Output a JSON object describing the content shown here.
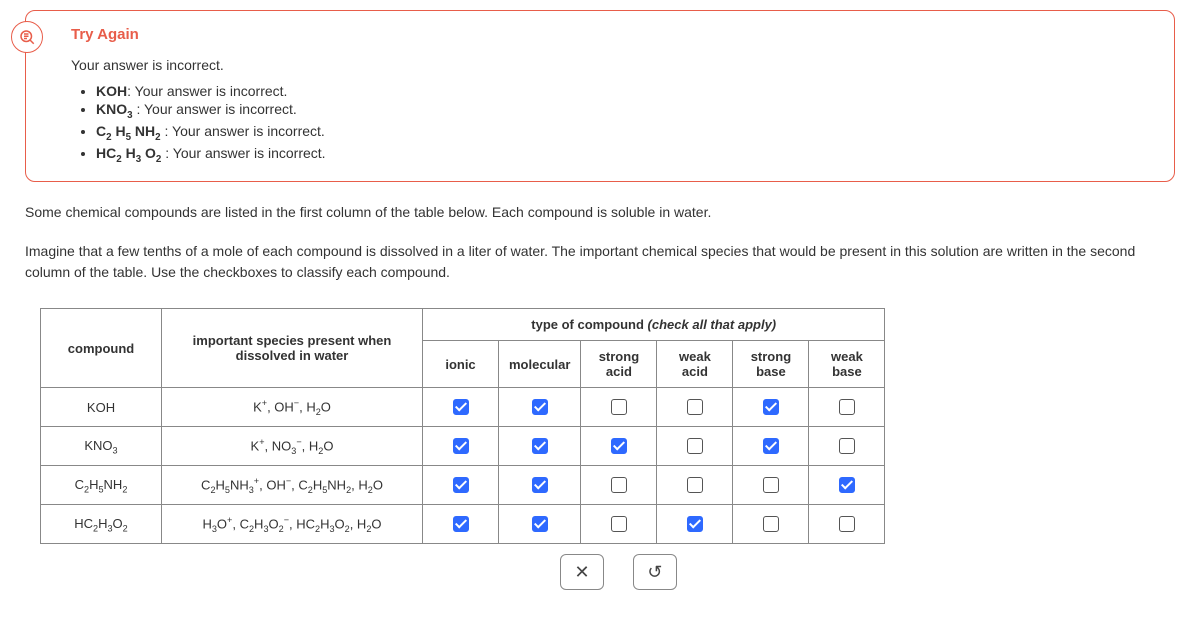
{
  "feedback": {
    "title": "Try Again",
    "summary": "Your answer is incorrect.",
    "items": [
      {
        "compound_html": "KOH",
        "msg": ": Your answer is incorrect."
      },
      {
        "compound_html": "KNO<sub>3</sub>",
        "msg": " : Your answer is incorrect."
      },
      {
        "compound_html": "C<sub>2</sub> H<sub>5</sub> NH<sub>2</sub>",
        "msg": " : Your answer is incorrect."
      },
      {
        "compound_html": "HC<sub>2</sub> H<sub>3</sub> O<sub>2</sub>",
        "msg": " : Your answer is incorrect."
      }
    ]
  },
  "question": {
    "p1": "Some chemical compounds are listed in the first column of the table below. Each compound is soluble in water.",
    "p2": "Imagine that a few tenths of a mole of each compound is dissolved in a liter of water. The important chemical species that would be present in this solution are written in the second column of the table. Use the checkboxes to classify each compound."
  },
  "table": {
    "col_compound": "compound",
    "col_species": "important species present when dissolved in water",
    "col_type_header": "type of compound",
    "col_type_hint": " (check all that apply)",
    "cols": [
      "ionic",
      "molecular",
      "strong acid",
      "weak acid",
      "strong base",
      "weak base"
    ],
    "rows": [
      {
        "compound_html": "KOH",
        "species_html": "K<sup>+</sup>, OH<sup>−</sup>, H<sub>2</sub>O",
        "checks": [
          true,
          true,
          false,
          false,
          true,
          false
        ]
      },
      {
        "compound_html": "KNO<sub>3</sub>",
        "species_html": "K<sup>+</sup>, NO<sub>3</sub><sup>−</sup>, H<sub>2</sub>O",
        "checks": [
          true,
          true,
          true,
          false,
          true,
          false
        ]
      },
      {
        "compound_html": "C<sub>2</sub>H<sub>5</sub>NH<sub>2</sub>",
        "species_html": "C<sub>2</sub>H<sub>5</sub>NH<sub>3</sub><sup>+</sup>, OH<sup>−</sup>, C<sub>2</sub>H<sub>5</sub>NH<sub>2</sub>, H<sub>2</sub>O",
        "checks": [
          true,
          true,
          false,
          false,
          false,
          true
        ]
      },
      {
        "compound_html": "HC<sub>2</sub>H<sub>3</sub>O<sub>2</sub>",
        "species_html": "H<sub>3</sub>O<sup>+</sup>, C<sub>2</sub>H<sub>3</sub>O<sub>2</sub><sup>−</sup>, HC<sub>2</sub>H<sub>3</sub>O<sub>2</sub>, H<sub>2</sub>O",
        "checks": [
          true,
          true,
          false,
          true,
          false,
          false
        ]
      }
    ]
  },
  "buttons": {
    "clear": "✕",
    "reset": "↺"
  }
}
